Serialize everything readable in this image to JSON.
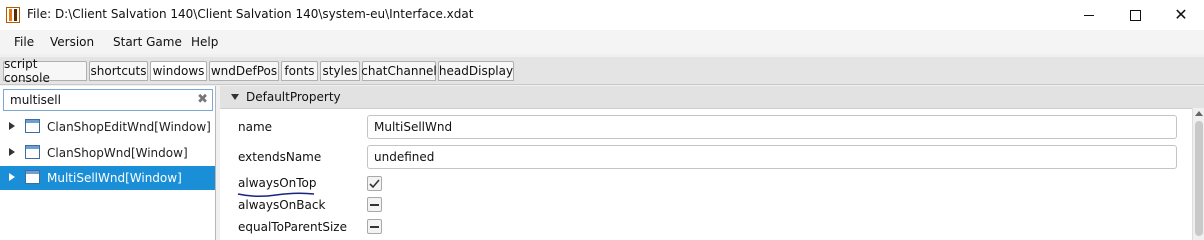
{
  "window": {
    "title": "File: D:\\Client Salvation 140\\Client Salvation 140\\system-eu\\Interface.xdat"
  },
  "menu": [
    "File",
    "Version",
    "Start Game",
    "Help"
  ],
  "tabs": [
    "script console",
    "shortcuts",
    "windows",
    "wndDefPos",
    "fonts",
    "styles",
    "chatChannel",
    "headDisplay"
  ],
  "active_tab": "windows",
  "search": {
    "value": "multisell"
  },
  "tree": [
    {
      "label": "ClanShopEditWnd[Window]",
      "selected": false
    },
    {
      "label": "ClanShopWnd[Window]",
      "selected": false
    },
    {
      "label": "MultiSellWnd[Window]",
      "selected": true
    }
  ],
  "section": {
    "title": "DefaultProperty"
  },
  "properties": {
    "name": {
      "label": "name",
      "value": "MultiSellWnd"
    },
    "extendsName": {
      "label": "extendsName",
      "value": "undefined"
    },
    "alwaysOnTop": {
      "label": "alwaysOnTop",
      "state": "checked"
    },
    "alwaysOnBack": {
      "label": "alwaysOnBack",
      "state": "indeterminate"
    },
    "equalToParentSize": {
      "label": "equalToParentSize",
      "state": "indeterminate"
    }
  },
  "colors": {
    "selection": "#1a8fd8",
    "annotation_ink": "#1a237e"
  }
}
